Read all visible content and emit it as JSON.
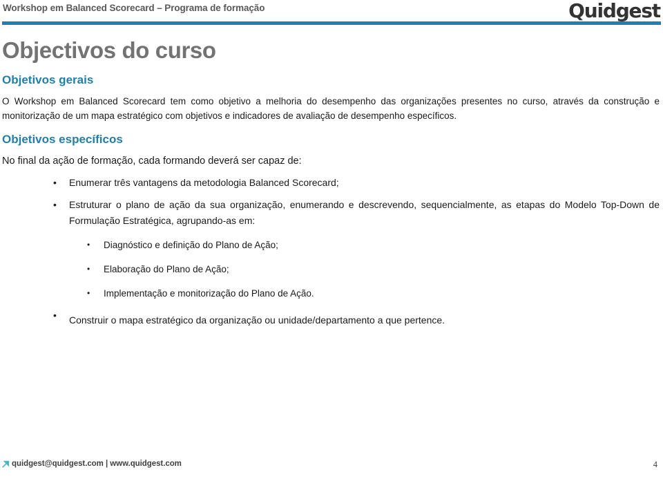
{
  "header": {
    "title": "Workshop em Balanced Scorecard – Programa de formação",
    "brand": "Quidgest",
    "rule_color": "#1f7fad"
  },
  "slide": {
    "title": "Objectivos do curso",
    "section_general": {
      "heading": "Objetivos gerais",
      "paragraph": "O Workshop em Balanced Scorecard tem como objetivo a melhoria do desempenho das organizações presentes no curso, através da construção e monitorização de um mapa estratégico com objetivos e indicadores de avaliação de desempenho específicos."
    },
    "section_specific": {
      "heading": "Objetivos específicos",
      "lead": "No final da ação de formação, cada formando deverá ser capaz de:",
      "bullets": [
        "Enumerar três vantagens da metodologia Balanced Scorecard;",
        "Estruturar o plano de ação da sua organização, enumerando e descrevendo, sequencialmente, as etapas do Modelo Top-Down de Formulação Estratégica, agrupando-as em:",
        "Construir o mapa estratégico da organização ou unidade/departamento a que pertence."
      ],
      "sub_bullets": [
        "Diagnóstico e definição do Plano de Ação;",
        "Elaboração do Plano de Ação;",
        "Implementação e monitorização do Plano de Ação."
      ],
      "bullet_glyph": "•"
    },
    "heading_color": "#1f7fad",
    "title_color": "#737373"
  },
  "footer": {
    "contact": "quidgest@quidgest.com | www.quidgest.com",
    "page_number": "4",
    "arrow_icon": "arrow-up-right-icon",
    "arrow_color": "#45b5c4"
  }
}
